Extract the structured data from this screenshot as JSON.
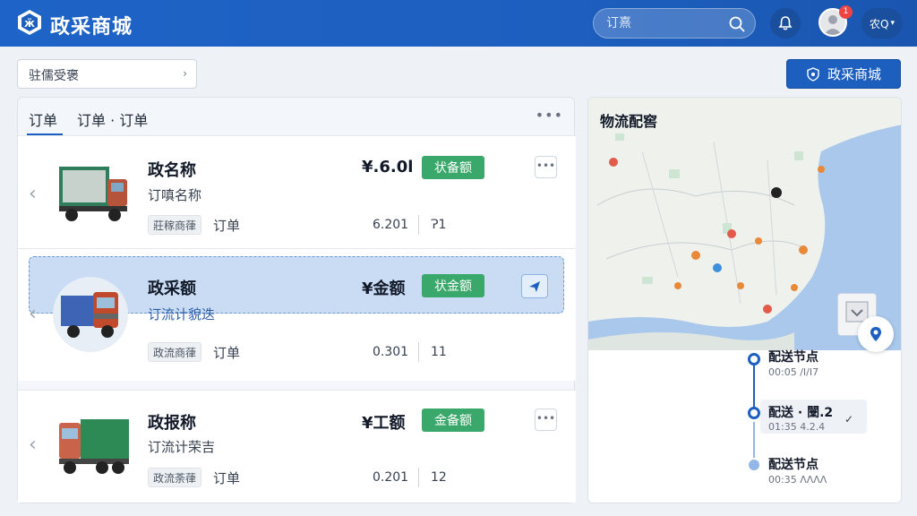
{
  "header": {
    "brand": "政采商城",
    "search_placeholder": "订熹",
    "notification_count": "1",
    "lang_label": "农Q"
  },
  "filter": {
    "select_value": "驻儒受褒",
    "primary_button": "政采商城"
  },
  "orders": {
    "tabs": [
      "订单",
      "订单 · 订单"
    ],
    "more": "•••",
    "items": [
      {
        "title": "政名称",
        "subtitle": "订嗔名称",
        "tag": "莊稼商葎",
        "kind": "订单",
        "price": "¥.6.0l",
        "status": "状备额",
        "num1": "6.201",
        "num2": "Ɂ1",
        "menu": "•••"
      },
      {
        "title": "政采额",
        "subtitle": "订流计貌迭",
        "tag": "政流商葎",
        "kind": "订单",
        "price": "¥金额",
        "status": "状金额",
        "num1": "0.301",
        "num2": "11"
      },
      {
        "title": "政报称",
        "subtitle": "订流计荣吉",
        "tag": "政流荼葎",
        "kind": "订单",
        "price": "¥工额",
        "status": "金备额",
        "num1": "0.201",
        "num2": "12",
        "menu": "•••"
      }
    ]
  },
  "logistics": {
    "title": "物流配窖",
    "timeline": [
      {
        "title": "配送节点",
        "time": "00:05 /I/I7"
      },
      {
        "title": "配送 · 闛.2",
        "time": "01:35 4.2.4"
      },
      {
        "title": "配送节点",
        "time": "00:35 ɅɅɅɅ"
      }
    ]
  },
  "colors": {
    "primary": "#1d5fbf",
    "status_green": "#3aa86a",
    "highlight": "#c9dcf3"
  }
}
